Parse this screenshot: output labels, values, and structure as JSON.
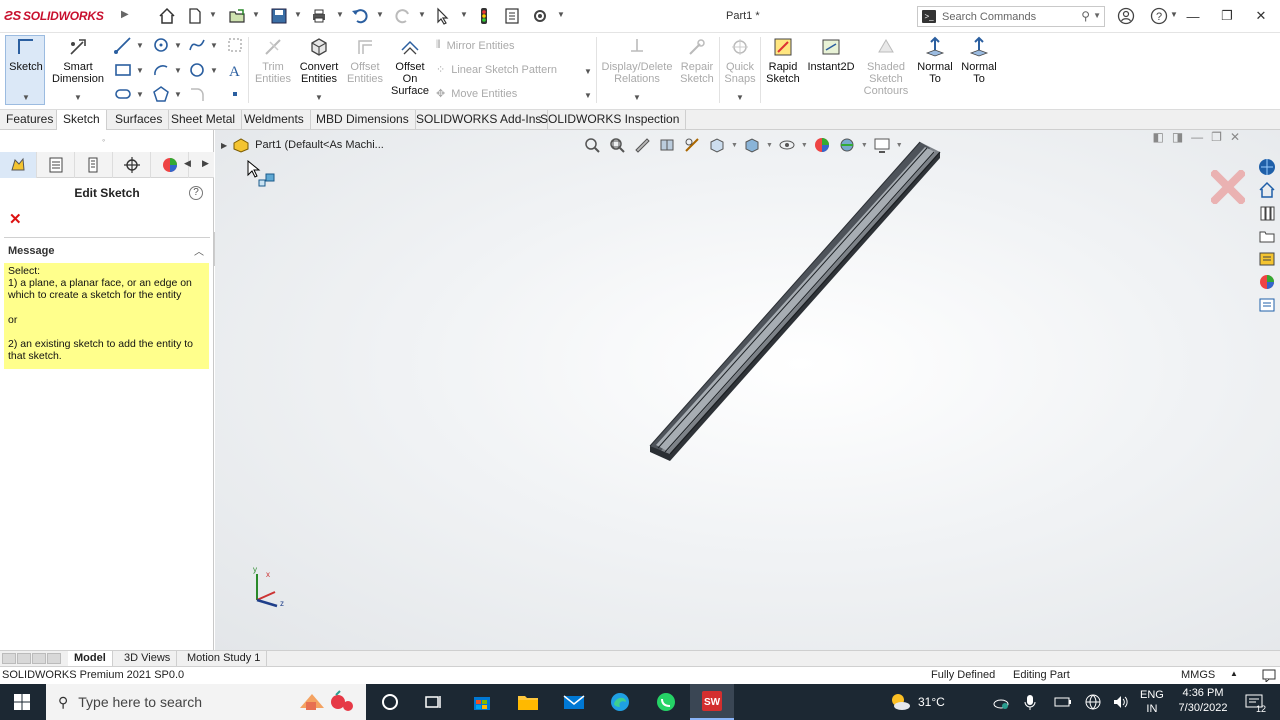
{
  "titlebar": {
    "app_name": "SOLIDWORKS",
    "doc_title": "Part1 *",
    "search_placeholder": "Search Commands"
  },
  "commands": {
    "sketch": "Sketch",
    "smart_dimension": [
      "Smart",
      "Dimension"
    ],
    "trim": [
      "Trim",
      "Entities"
    ],
    "convert": [
      "Convert",
      "Entities"
    ],
    "offset": [
      "Offset",
      "Entities"
    ],
    "offset_surface": [
      "Offset",
      "On",
      "Surface"
    ],
    "mirror": "Mirror Entities",
    "linear_pattern": "Linear Sketch Pattern",
    "move": "Move Entities",
    "display_delete": [
      "Display/Delete",
      "Relations"
    ],
    "repair": [
      "Repair",
      "Sketch"
    ],
    "quick_snaps": [
      "Quick",
      "Snaps"
    ],
    "rapid_sketch": [
      "Rapid",
      "Sketch"
    ],
    "instant2d": "Instant2D",
    "shaded_contours": [
      "Shaded",
      "Sketch",
      "Contours"
    ],
    "normal_to_1": [
      "Normal",
      "To"
    ],
    "normal_to_2": [
      "Normal",
      "To"
    ]
  },
  "tabs": [
    "Features",
    "Sketch",
    "Surfaces",
    "Sheet Metal",
    "Weldments",
    "MBD Dimensions",
    "SOLIDWORKS Add-Ins",
    "SOLIDWORKS Inspection"
  ],
  "active_tab": "Sketch",
  "property_manager": {
    "title": "Edit Sketch",
    "message_header": "Message",
    "message_lines": [
      "Select:",
      "1) a plane, a planar face, or an edge on which to create a sketch for the entity",
      "",
      "or",
      "",
      "2) an existing sketch to add the entity to that sketch."
    ]
  },
  "feature_tree": {
    "root": "Part1  (Default<As Machi..."
  },
  "triad_labels": {
    "x": "x",
    "y": "y",
    "z": "z"
  },
  "bottom_tabs": [
    "Model",
    "3D Views",
    "Motion Study 1"
  ],
  "active_bottom_tab": "Model",
  "status": {
    "version": "SOLIDWORKS Premium 2021 SP0.0",
    "defined": "Fully Defined",
    "mode": "Editing Part",
    "units": "MMGS"
  },
  "taskbar": {
    "search_placeholder": "Type here to search",
    "temperature": "31°C",
    "lang_top": "ENG",
    "lang_bottom": "IN",
    "time": "4:36 PM",
    "date": "7/30/2022",
    "notifications": "12"
  },
  "colors": {
    "brand_red": "#c8102e",
    "message_yellow": "#ffff8c",
    "taskbar": "#1c2833",
    "sketch_active": "#dbe8f7"
  }
}
